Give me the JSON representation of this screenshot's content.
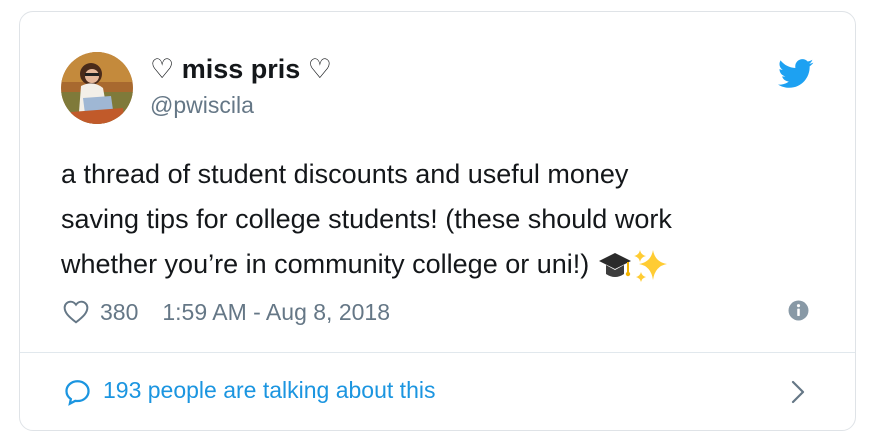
{
  "tweet": {
    "display_name": "♡ miss pris ♡",
    "handle": "@pwiscila",
    "text_lines": [
      "a thread of student discounts and useful money",
      "saving tips for college students! (these should work",
      "whether you’re in community college or uni!)"
    ],
    "emojis": [
      "graduation-cap",
      "sparkles"
    ],
    "likes": "380",
    "timestamp": "1:59 AM - Aug 8, 2018",
    "conversation_label": "193 people are talking about this"
  },
  "colors": {
    "twitter_blue": "#1da1f2",
    "link_blue": "#1b95e0",
    "text": "#14171a",
    "muted": "#657786",
    "border": "#dfe3e7"
  },
  "icons": {
    "brand": "twitter-bird-icon",
    "like": "heart-outline-icon",
    "info": "info-circle-icon",
    "reply": "speech-bubble-icon",
    "more": "chevron-right-icon"
  }
}
